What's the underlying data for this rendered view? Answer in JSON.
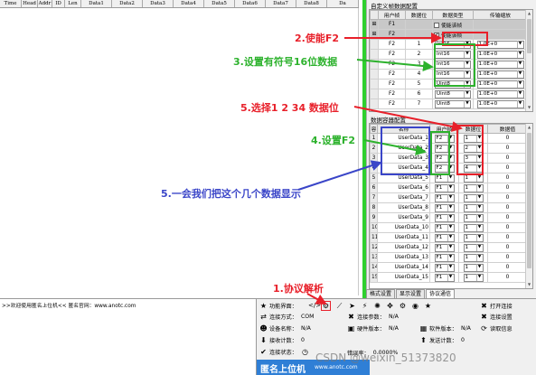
{
  "left_table": {
    "columns": [
      "Time",
      "Head",
      "Addr",
      "ID",
      "Len",
      "Data1",
      "Data2",
      "Data3",
      "Data4",
      "Data5",
      "Data6",
      "Data7",
      "Data8",
      "Da"
    ]
  },
  "custom_frame": {
    "title": "自定义帧数据配置",
    "headers": [
      "",
      "用户帧",
      "数据位",
      "数据类型",
      "传输缩放"
    ],
    "rows": [
      {
        "frame": "F1",
        "bit": "",
        "type_check": "使能该帧",
        "checked": false,
        "scale": "",
        "shaded": true
      },
      {
        "frame": "F2",
        "bit": "",
        "type_check": "使能该帧",
        "checked": true,
        "scale": "",
        "shaded": true
      },
      {
        "frame": "F2",
        "bit": "1",
        "type": "Int16",
        "scale": "1.0E+0"
      },
      {
        "frame": "F2",
        "bit": "2",
        "type": "Int16",
        "scale": "1.0E+0"
      },
      {
        "frame": "F2",
        "bit": "3",
        "type": "Int16",
        "scale": "1.0E+0"
      },
      {
        "frame": "F2",
        "bit": "4",
        "type": "Int16",
        "scale": "1.0E+0"
      },
      {
        "frame": "F2",
        "bit": "5",
        "type": "Uint8",
        "scale": "1.0E+0"
      },
      {
        "frame": "F2",
        "bit": "6",
        "type": "Uint8",
        "scale": "1.0E+0"
      },
      {
        "frame": "F2",
        "bit": "7",
        "type": "Uint8",
        "scale": "1.0E+0"
      }
    ]
  },
  "container": {
    "title": "数据容器配置",
    "headers": [
      "容",
      "名称",
      "用户帧",
      "数据位",
      "数据值"
    ],
    "rows": [
      {
        "n": "1",
        "name": "UserData_1",
        "frame": "F2",
        "bit": "1",
        "value": "0"
      },
      {
        "n": "2",
        "name": "UserData_2",
        "frame": "F2",
        "bit": "2",
        "value": "0"
      },
      {
        "n": "3",
        "name": "UserData_3",
        "frame": "F2",
        "bit": "3",
        "value": "0"
      },
      {
        "n": "4",
        "name": "UserData_4",
        "frame": "F2",
        "bit": "4",
        "value": "0"
      },
      {
        "n": "5",
        "name": "UserData_5",
        "frame": "F1",
        "bit": "1",
        "value": "0"
      },
      {
        "n": "6",
        "name": "UserData_6",
        "frame": "F1",
        "bit": "1",
        "value": "0"
      },
      {
        "n": "7",
        "name": "UserData_7",
        "frame": "F1",
        "bit": "1",
        "value": "0"
      },
      {
        "n": "8",
        "name": "UserData_8",
        "frame": "F1",
        "bit": "1",
        "value": "0"
      },
      {
        "n": "9",
        "name": "UserData_9",
        "frame": "F1",
        "bit": "1",
        "value": "0"
      },
      {
        "n": "10",
        "name": "UserData_10",
        "frame": "F1",
        "bit": "1",
        "value": "0"
      },
      {
        "n": "11",
        "name": "UserData_11",
        "frame": "F1",
        "bit": "1",
        "value": "0"
      },
      {
        "n": "12",
        "name": "UserData_12",
        "frame": "F1",
        "bit": "1",
        "value": "0"
      },
      {
        "n": "13",
        "name": "UserData_13",
        "frame": "F1",
        "bit": "1",
        "value": "0"
      },
      {
        "n": "14",
        "name": "UserData_14",
        "frame": "F1",
        "bit": "1",
        "value": "0"
      },
      {
        "n": "15",
        "name": "UserData_15",
        "frame": "F1",
        "bit": "1",
        "value": "0"
      }
    ]
  },
  "tabs": [
    "格式设置",
    "显示设置",
    "协议通信"
  ],
  "status_left": {
    "line": ">>欢迎使用匿名上位机<<  匿名官网：www.anotc.com"
  },
  "bottom": {
    "func_label": "功能界面：",
    "conn_mode_label": "连接方式：",
    "conn_mode_value": "COM",
    "conn_params_label": "连接参数：",
    "conn_params_value": "N/A",
    "device_name_label": "设备名称：",
    "device_name_value": "N/A",
    "hw_ver_label": "硬件版本：",
    "hw_ver_value": "N/A",
    "sw_ver_label": "软件版本：",
    "sw_ver_value": "N/A",
    "rx_count_label": "接收计数：",
    "rx_count_value": "0",
    "tx_count_label": "发送计数：",
    "tx_count_value": "0",
    "conn_status_label": "连接状态：",
    "err_rate_label": "错误率：",
    "err_rate_value": "0.0000%",
    "open_conn": "打开连接",
    "conn_settings": "连接设置",
    "read_info": "读取信息",
    "brand": "匿名上位机",
    "brand_url": "www.anotc.com"
  },
  "annotations": {
    "a1": "1.协议解析",
    "a2": "2.使能F2",
    "a3": "3.设置有符号16位数据",
    "a4": "4.设置F2",
    "a5": "5.选择1 2 34 数据位",
    "a5b": "5.一会我们把这个几个数据显示"
  },
  "watermark": "CSDN @weixin_51373820",
  "colors": {
    "red": "#e8202a",
    "green": "#2db22d",
    "blue": "#3a45c8",
    "splitter": "#2ed02e",
    "brand": "#2f7fd6"
  }
}
